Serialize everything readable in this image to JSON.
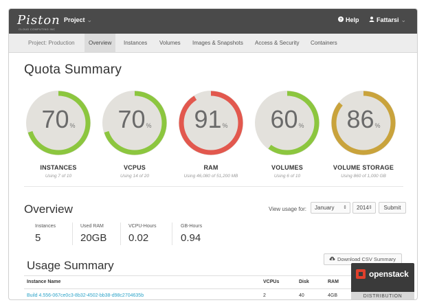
{
  "app": {
    "logo": "Piston",
    "logo_sub": "CLOUD COMPUTING INC"
  },
  "topbar": {
    "project_label": "Project",
    "help_label": "Help",
    "user_label": "Fattarsi"
  },
  "nav": {
    "project_label": "Project: Production",
    "tabs": [
      "Overview",
      "Instances",
      "Volumes",
      "Images & Snapshots",
      "Access & Security",
      "Containers"
    ],
    "active_tab": "Overview"
  },
  "quota": {
    "title": "Quota Summary",
    "gauges": [
      {
        "value": "70",
        "fraction": 0.7,
        "color": "#8cc63f",
        "label": "INSTANCES",
        "sub": "Using 7 of 10"
      },
      {
        "value": "70",
        "fraction": 0.7,
        "color": "#8cc63f",
        "label": "VCPUS",
        "sub": "Using 14 of 20"
      },
      {
        "value": "91",
        "fraction": 0.91,
        "color": "#e2584e",
        "label": "RAM",
        "sub": "Using 46,080 of 51,200 MB"
      },
      {
        "value": "60",
        "fraction": 0.6,
        "color": "#8cc63f",
        "label": "VOLUMES",
        "sub": "Using 6 of 10"
      },
      {
        "value": "86",
        "fraction": 0.86,
        "color": "#c9a33c",
        "label": "VOLUME STORAGE",
        "sub": "Using 860 of 1,000 GB"
      }
    ],
    "percent_sign": "%"
  },
  "overview": {
    "title": "Overview",
    "view_usage_label": "View usage for:",
    "month": "January",
    "year": "2014",
    "submit_label": "Submit",
    "stats": [
      {
        "label": "Instances",
        "value": "5"
      },
      {
        "label": "Used RAM",
        "value": "20GB"
      },
      {
        "label": "VCPU-Hours",
        "value": "0.02"
      },
      {
        "label": "GB-Hours",
        "value": "0.94"
      }
    ]
  },
  "usage": {
    "title": "Usage Summary",
    "download_label": "Download CSV Summary",
    "columns": [
      "Instance Name",
      "VCPUs",
      "Disk",
      "RAM"
    ],
    "rows": [
      {
        "name": "Build 4.556-067ce0c3-8b32-4502-bb38-d98c2704635b",
        "vcpus": "2",
        "disk": "40",
        "ram": "4GB"
      }
    ]
  },
  "badge": {
    "brand": "openstack",
    "distribution": "DISTRIBUTION"
  },
  "colors": {
    "green": "#8cc63f",
    "red": "#e2584e",
    "gold": "#c9a33c",
    "link": "#2ba3c8"
  }
}
